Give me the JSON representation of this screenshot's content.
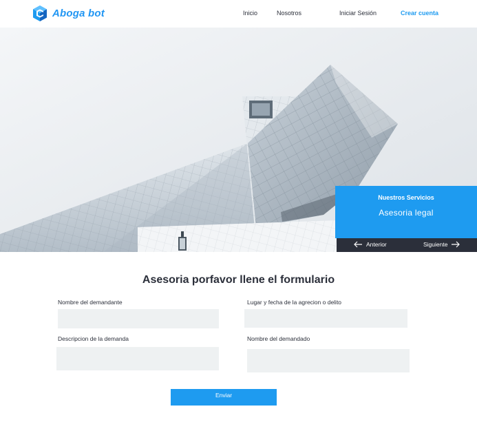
{
  "brand": {
    "name": "Aboga bot",
    "color": "#2196f3"
  },
  "nav": {
    "inicio": "Inicio",
    "nosotros": "Nosotros",
    "login": "Iniciar Sesión",
    "signup": "Crear cuenta"
  },
  "hero": {
    "services_title": "Nuestros Servicios",
    "services_item": "Asesoria legal",
    "prev": "Anterior",
    "next": "Siguiente"
  },
  "form": {
    "title": "Asesoria porfavor llene el formulario",
    "fields": {
      "demandante": {
        "label": "Nombre del demandante",
        "value": ""
      },
      "lugar_fecha": {
        "label": "Lugar y fecha de la agrecion o delito",
        "value": ""
      },
      "descripcion": {
        "label": "Descripcion de la demanda",
        "value": ""
      },
      "demandado": {
        "label": "Nombre del demandado",
        "value": ""
      }
    },
    "submit": "Enviar"
  },
  "colors": {
    "accent": "#1e9bf0",
    "dark": "#2b2f3a",
    "field_bg": "#eef1f2"
  }
}
